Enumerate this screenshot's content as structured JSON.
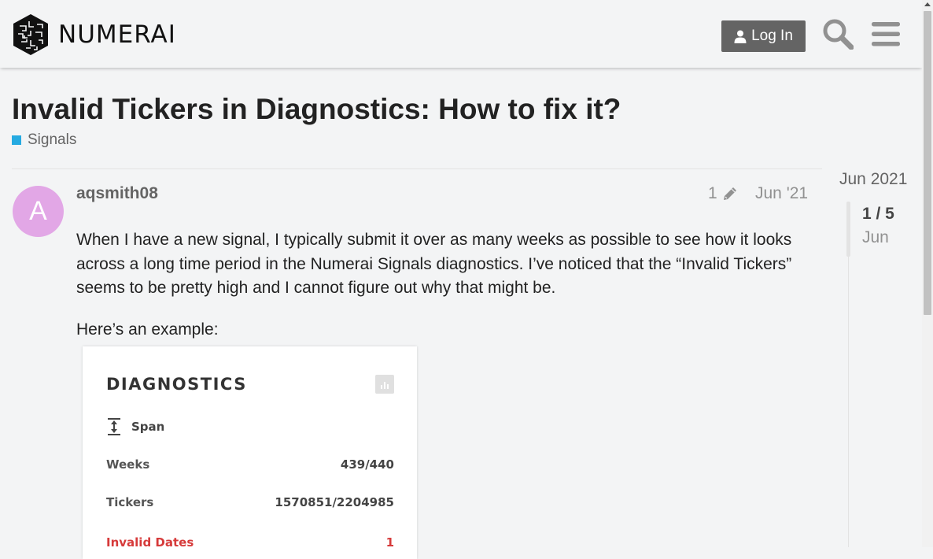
{
  "header": {
    "logo_text": "NUMERAI",
    "login_label": "Log In"
  },
  "topic": {
    "title": "Invalid Tickers in Diagnostics: How to fix it?",
    "category": "Signals",
    "category_color": "#25aae1"
  },
  "post": {
    "avatar_letter": "A",
    "avatar_color": "#e2a7e6",
    "username": "aqsmith08",
    "edit_count": "1",
    "date": "Jun '21",
    "paragraphs": [
      "When I have a new signal, I typically submit it over as many weeks as possible to see how it looks across a long time period in the Numerai Signals diagnostics. I’ve noticed that the “Invalid Tickers” seems to be pretty high and I cannot figure out why that might be.",
      "Here’s an example:"
    ]
  },
  "diagnostics_image": {
    "title": "DIAGNOSTICS",
    "span_label": "Span",
    "rows": [
      {
        "label": "Weeks",
        "value": "439/440"
      },
      {
        "label": "Tickers",
        "value": "1570851/2204985"
      },
      {
        "label": "Invalid Dates",
        "value": "1"
      }
    ],
    "invalid_color": "#d63a3a"
  },
  "timeline": {
    "start": "Jun 2021",
    "count": "1 / 5",
    "date": "Jun"
  },
  "icons": {
    "login": "user-icon",
    "search": "search-icon",
    "menu": "hamburger-menu-icon",
    "edit": "pencil-icon",
    "chart": "bar-chart-icon",
    "span": "vertical-span-icon"
  }
}
